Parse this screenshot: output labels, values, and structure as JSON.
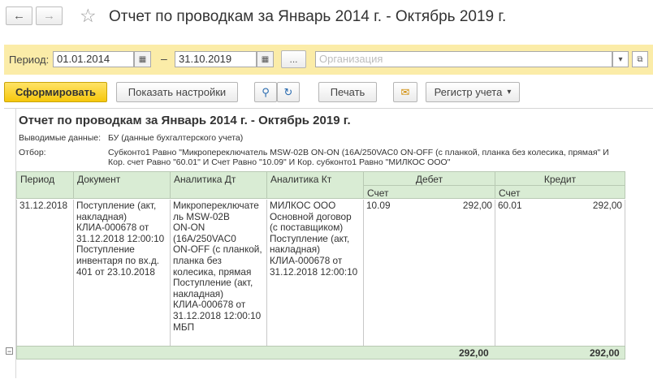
{
  "window": {
    "title": "Отчет по проводкам за Январь 2014 г. - Октябрь 2019 г.",
    "back_glyph": "←",
    "forward_glyph": "→",
    "favorite_glyph": "☆"
  },
  "period_panel": {
    "label": "Период:",
    "date_from": "01.01.2014",
    "separator": "–",
    "date_to": "31.10.2019",
    "more_button": "...",
    "organization_placeholder": "Организация",
    "dropdown_glyph": "▾",
    "open_glyph": "⧉",
    "calendar_glyph": "▦"
  },
  "toolbar": {
    "generate": "Сформировать",
    "show_settings": "Показать настройки",
    "search_glyph": "🔍",
    "print": "Печать",
    "mail_glyph": "✉",
    "register": "Регистр учета",
    "register_arrow": "▾"
  },
  "report": {
    "title": "Отчет по проводкам за Январь 2014 г. - Октябрь 2019 г.",
    "output_label": "Выводимые данные:",
    "output_value": "БУ (данные бухгалтерского учета)",
    "filter_label": "Отбор:",
    "filter_line1": "Субконто1 Равно \"Микропереключатель MSW-02B ON-ON (16А/250VAC0 ON-OFF (с планкой, планка без колесика, прямая\" И",
    "filter_line2": "Кор. счет Равно \"60.01\" И Счет Равно \"10.09\" И Кор. субконто1 Равно \"МИЛКОС ООО\"",
    "columns": {
      "period": "Период",
      "document": "Документ",
      "analytics_dt": "Аналитика Дт",
      "analytics_kt": "Аналитика Кт",
      "debit": "Дебет",
      "credit": "Кредит",
      "account_dt": "Счет",
      "account_kt": "Счет"
    },
    "row": {
      "period": "31.12.2018",
      "document": "Поступление (акт,\nнакладная)\nКЛИА-000678 от\n31.12.2018 12:00:10\nПоступление\nинвентаря по вх.д.\n401 от 23.10.2018",
      "analytics_dt": "Микропереключате\nль MSW-02B\nON-ON\n(16А/250VAC0\nON-OFF (с планкой,\nпланка без\nколесика, прямая\nПоступление (акт,\nнакладная)\nКЛИА-000678 от\n31.12.2018 12:00:10\n МБП",
      "analytics_kt": "МИЛКОС ООО\nОсновной договор\n(с поставщиком)\nПоступление (акт,\nнакладная)\nКЛИА-000678 от\n31.12.2018 12:00:10",
      "account_dt": "10.09",
      "debit_amount": "292,00",
      "account_kt": "60.01",
      "credit_amount": "292,00"
    },
    "totals": {
      "debit": "292,00",
      "credit": "292,00",
      "collapse_glyph": "−"
    }
  }
}
